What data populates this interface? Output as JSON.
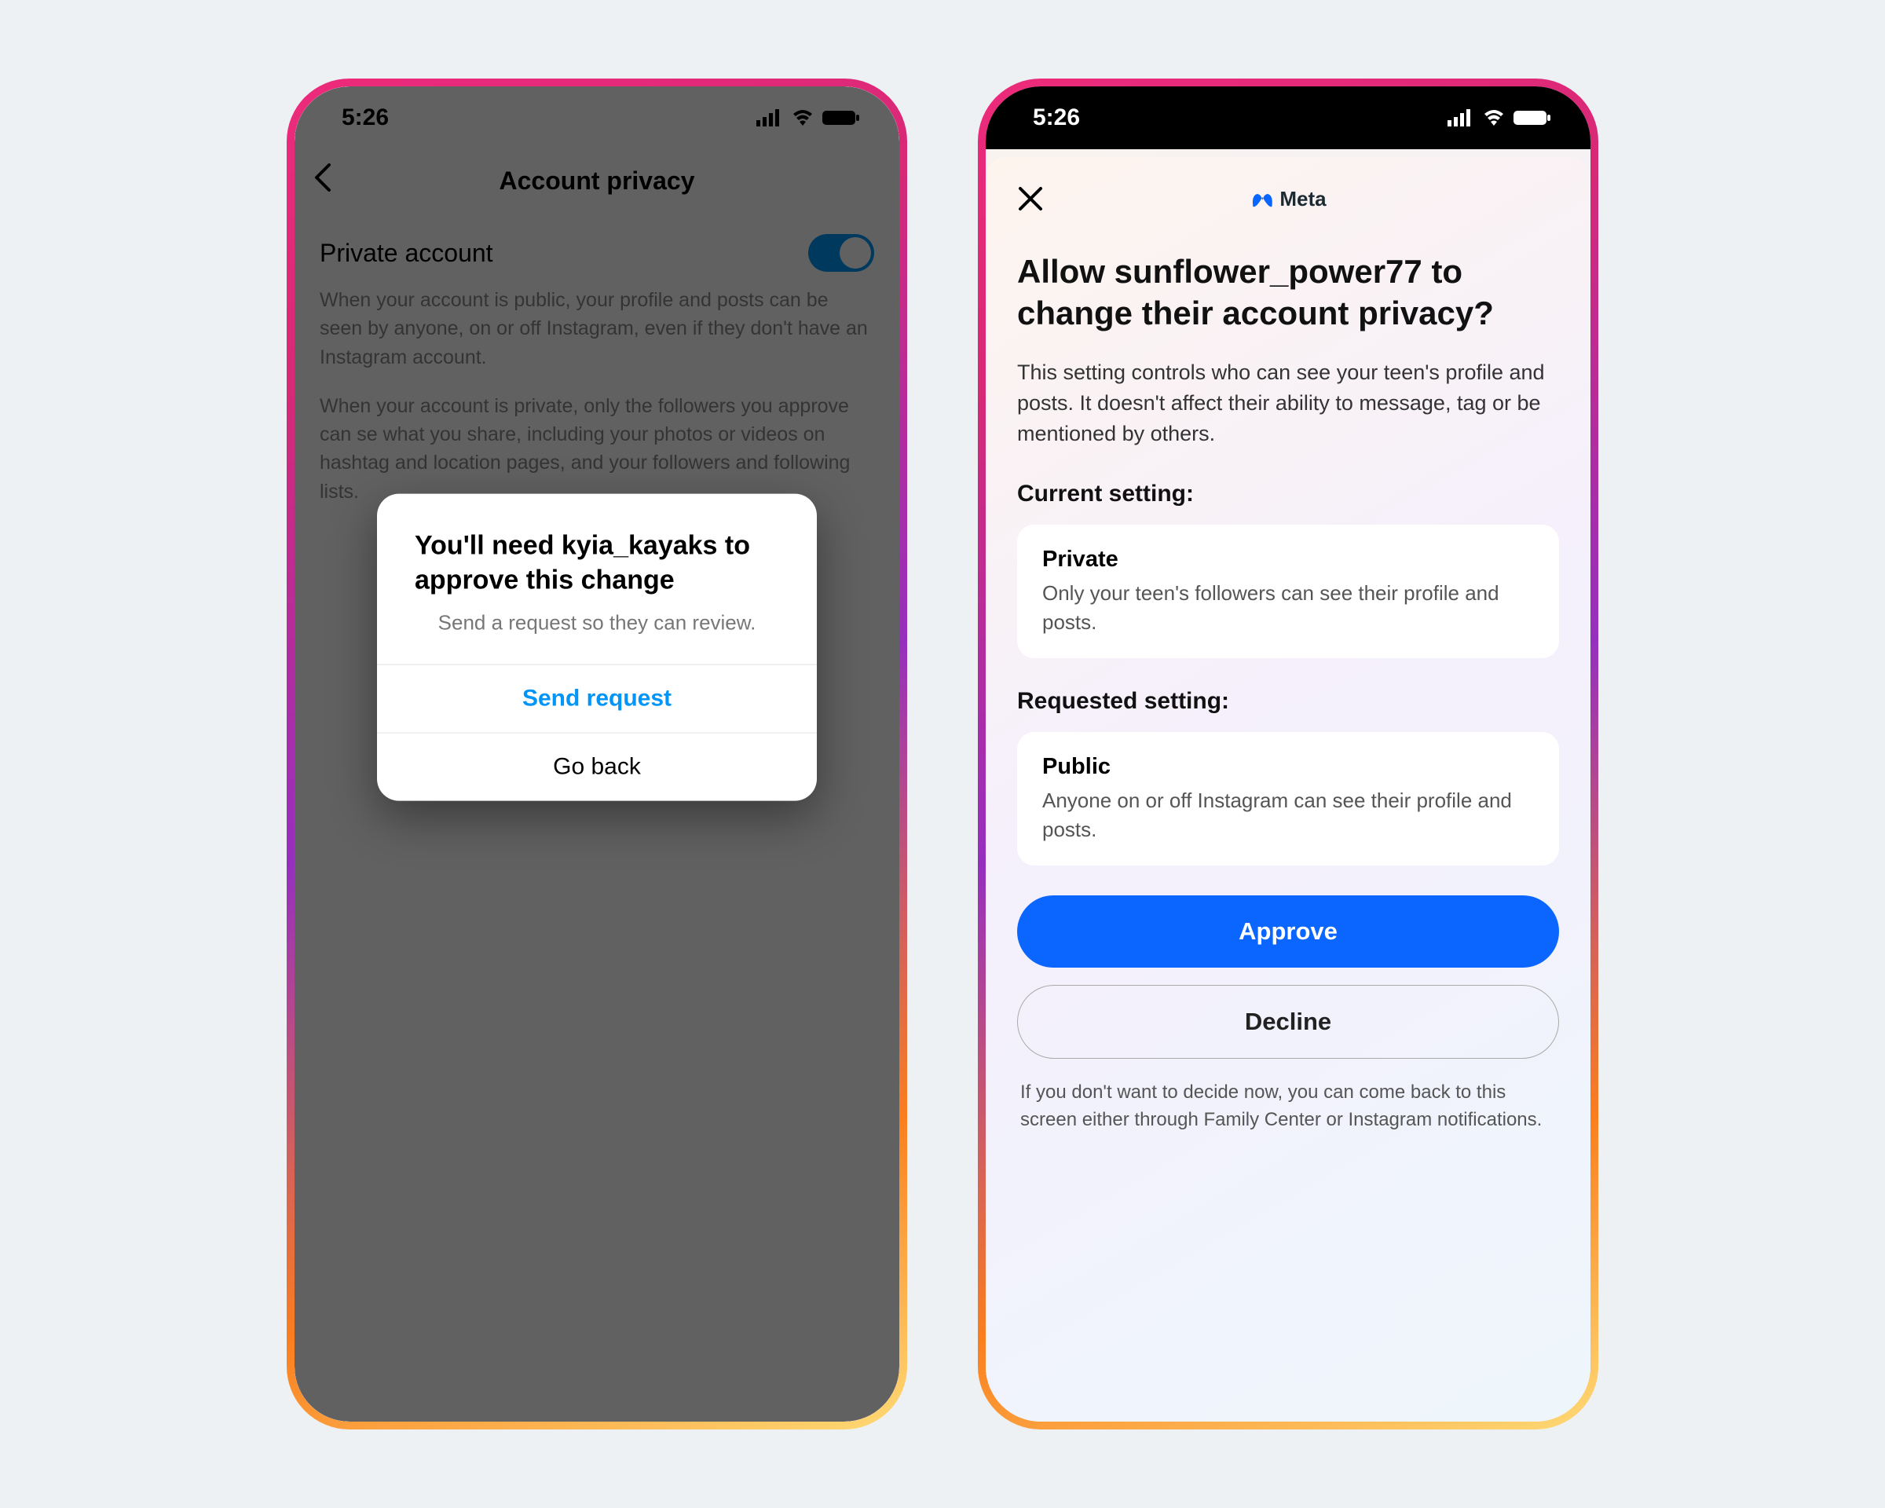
{
  "status": {
    "time": "5:26"
  },
  "left": {
    "header_title": "Account privacy",
    "row_label": "Private account",
    "desc1": "When your account is public, your profile and posts can be seen by anyone, on or off Instagram, even if they don't have an Instagram account.",
    "desc2": "When your account is private, only the followers you approve can se what you share, including your photos or videos on hashtag and location pages, and your followers and following lists.",
    "alert_title": "You'll need kyia_kayaks to approve this change",
    "alert_sub": "Send a request so they can review.",
    "alert_primary": "Send request",
    "alert_secondary": "Go back"
  },
  "right": {
    "brand": "Meta",
    "heading": "Allow sunflower_power77 to change their account privacy?",
    "lead": "This setting controls who can see your teen's profile and posts. It doesn't affect their ability to message, tag or be mentioned by others.",
    "current_label": "Current setting:",
    "current_title": "Private",
    "current_sub": "Only your teen's followers can see their profile and posts.",
    "requested_label": "Requested setting:",
    "requested_title": "Public",
    "requested_sub": "Anyone on or off Instagram can see their profile and posts.",
    "approve": "Approve",
    "decline": "Decline",
    "footer": "If you don't want to decide now, you can come back to this screen either through Family Center or Instagram notifications."
  }
}
